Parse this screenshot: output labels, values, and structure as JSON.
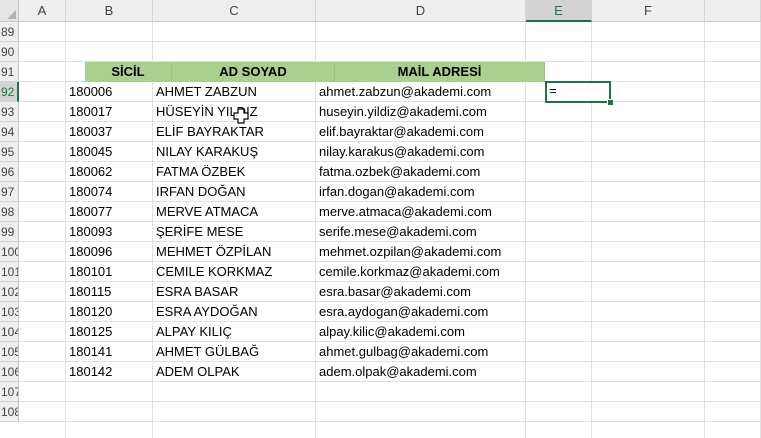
{
  "columns": [
    "A",
    "B",
    "C",
    "D",
    "E",
    "F"
  ],
  "selected_column": "E",
  "rows": [
    "89",
    "90",
    "91",
    "92",
    "93",
    "94",
    "95",
    "96",
    "97",
    "98",
    "99",
    "100",
    "101",
    "102",
    "103",
    "104",
    "105",
    "106",
    "107",
    "108"
  ],
  "selected_row": "92",
  "table_headers": {
    "sicil": "SİCİL",
    "ad_soyad": "AD SOYAD",
    "mail": "MAİL ADRESİ"
  },
  "records": [
    {
      "sicil": "180006",
      "ad": "AHMET ZABZUN",
      "mail": "ahmet.zabzun@akademi.com"
    },
    {
      "sicil": "180017",
      "ad": "HÜSEYİN YILDIZ",
      "mail": "huseyin.yildiz@akademi.com"
    },
    {
      "sicil": "180037",
      "ad": "ELİF BAYRAKTAR",
      "mail": "elif.bayraktar@akademi.com"
    },
    {
      "sicil": "180045",
      "ad": "NILAY KARAKUŞ",
      "mail": "nilay.karakus@akademi.com"
    },
    {
      "sicil": "180062",
      "ad": "FATMA ÖZBEK",
      "mail": "fatma.ozbek@akademi.com"
    },
    {
      "sicil": "180074",
      "ad": "IRFAN DOĞAN",
      "mail": "irfan.dogan@akademi.com"
    },
    {
      "sicil": "180077",
      "ad": "MERVE ATMACA",
      "mail": "merve.atmaca@akademi.com"
    },
    {
      "sicil": "180093",
      "ad": "ŞERİFE MESE",
      "mail": "serife.mese@akademi.com"
    },
    {
      "sicil": "180096",
      "ad": "MEHMET ÖZPİLAN",
      "mail": "mehmet.ozpilan@akademi.com"
    },
    {
      "sicil": "180101",
      "ad": "CEMILE KORKMAZ",
      "mail": "cemile.korkmaz@akademi.com"
    },
    {
      "sicil": "180115",
      "ad": "ESRA BASAR",
      "mail": "esra.basar@akademi.com"
    },
    {
      "sicil": "180120",
      "ad": "ESRA AYDOĞAN",
      "mail": "esra.aydogan@akademi.com"
    },
    {
      "sicil": "180125",
      "ad": "ALPAY KILIÇ",
      "mail": "alpay.kilic@akademi.com"
    },
    {
      "sicil": "180141",
      "ad": "AHMET GÜLBAĞ",
      "mail": "ahmet.gulbag@akademi.com"
    },
    {
      "sicil": "180142",
      "ad": "ADEM OLPAK",
      "mail": "adem.olpak@akademi.com"
    }
  ],
  "active_cell": {
    "ref": "E92",
    "value": "="
  },
  "colors": {
    "header_fill": "#a9d08e",
    "selection": "#217346"
  },
  "icons": {
    "cursor": "cell-select-cross-icon"
  }
}
